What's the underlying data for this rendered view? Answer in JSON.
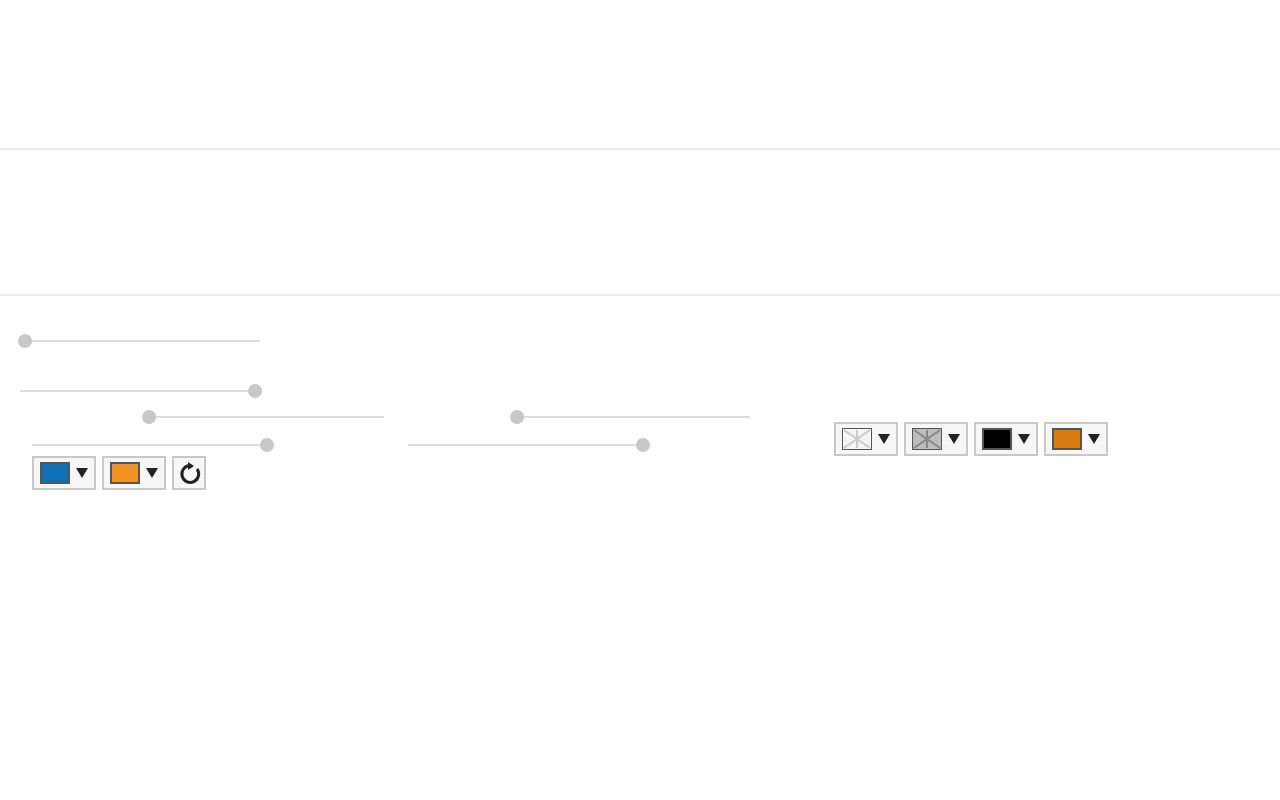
{
  "sliders": [
    {
      "level": 0.02
    },
    {
      "level": 0.99
    },
    {
      "level": 0.01
    },
    {
      "level": 1.0
    },
    {
      "level": 0.0
    },
    {
      "level": 1.0
    }
  ],
  "left_swatches": [
    {
      "kind": "color",
      "color": "#0f72b8"
    },
    {
      "kind": "color",
      "color": "#f39325"
    }
  ],
  "right_swatches": [
    {
      "kind": "pattern-light"
    },
    {
      "kind": "pattern-dark"
    },
    {
      "kind": "color",
      "color": "#000000"
    },
    {
      "kind": "color",
      "color": "#d97b10"
    }
  ]
}
